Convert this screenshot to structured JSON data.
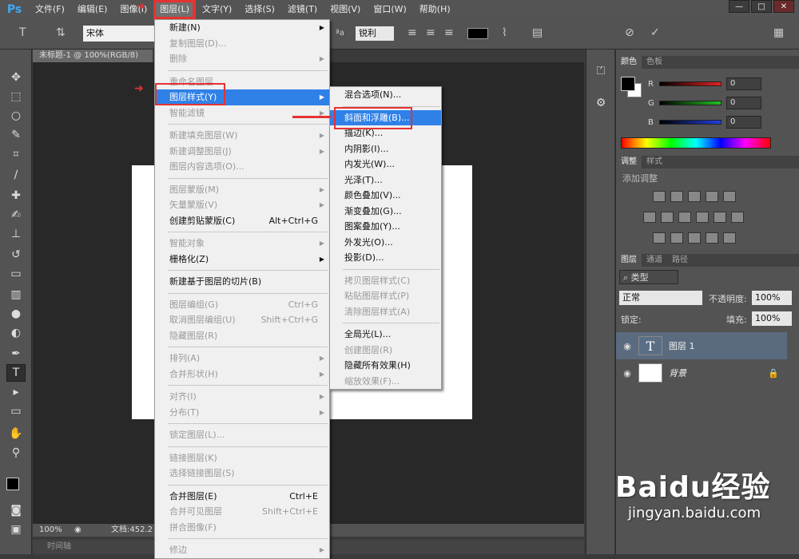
{
  "app": {
    "logo": "Ps"
  },
  "menubar": {
    "items": [
      "文件(F)",
      "编辑(E)",
      "图像(I)",
      "图层(L)",
      "文字(Y)",
      "选择(S)",
      "滤镜(T)",
      "视图(V)",
      "窗口(W)",
      "帮助(H)"
    ],
    "active_index": 3
  },
  "window_controls": [
    "—",
    "□",
    "✕"
  ],
  "options_bar": {
    "font": "宋体",
    "antialias": "锐利",
    "color": "#000000",
    "aa_label": "ªa"
  },
  "document": {
    "tab_title": "未标题-1 @ 100%(RGB/8)",
    "zoom": "100%",
    "doc_info": "文档:452.2",
    "timeline": "时间轴"
  },
  "layer_menu": [
    {
      "label": "新建(N)",
      "arrow": true
    },
    {
      "label": "复制图层(D)...",
      "disabled": true
    },
    {
      "label": "删除",
      "arrow": true,
      "disabled": true
    },
    {
      "sep": true
    },
    {
      "label": "重命名图层...",
      "disabled": true
    },
    {
      "label": "图层样式(Y)",
      "arrow": true,
      "highlighted": true
    },
    {
      "label": "智能滤镜",
      "arrow": true,
      "disabled": true
    },
    {
      "sep": true
    },
    {
      "label": "新建填充图层(W)",
      "arrow": true,
      "disabled": true
    },
    {
      "label": "新建调整图层(J)",
      "arrow": true,
      "disabled": true
    },
    {
      "label": "图层内容选项(O)...",
      "disabled": true
    },
    {
      "sep": true
    },
    {
      "label": "图层蒙版(M)",
      "arrow": true,
      "disabled": true
    },
    {
      "label": "矢量蒙版(V)",
      "arrow": true,
      "disabled": true
    },
    {
      "label": "创建剪贴蒙版(C)",
      "shortcut": "Alt+Ctrl+G"
    },
    {
      "sep": true
    },
    {
      "label": "智能对象",
      "arrow": true,
      "disabled": true
    },
    {
      "label": "栅格化(Z)",
      "arrow": true
    },
    {
      "sep": true
    },
    {
      "label": "新建基于图层的切片(B)"
    },
    {
      "sep": true
    },
    {
      "label": "图层编组(G)",
      "shortcut": "Ctrl+G",
      "disabled": true
    },
    {
      "label": "取消图层编组(U)",
      "shortcut": "Shift+Ctrl+G",
      "disabled": true
    },
    {
      "label": "隐藏图层(R)",
      "disabled": true
    },
    {
      "sep": true
    },
    {
      "label": "排列(A)",
      "arrow": true,
      "disabled": true
    },
    {
      "label": "合并形状(H)",
      "arrow": true,
      "disabled": true
    },
    {
      "sep": true
    },
    {
      "label": "对齐(I)",
      "arrow": true,
      "disabled": true
    },
    {
      "label": "分布(T)",
      "arrow": true,
      "disabled": true
    },
    {
      "sep": true
    },
    {
      "label": "锁定图层(L)...",
      "disabled": true
    },
    {
      "sep": true
    },
    {
      "label": "链接图层(K)",
      "disabled": true
    },
    {
      "label": "选择链接图层(S)",
      "disabled": true
    },
    {
      "sep": true
    },
    {
      "label": "合并图层(E)",
      "shortcut": "Ctrl+E"
    },
    {
      "label": "合并可见图层",
      "shortcut": "Shift+Ctrl+E",
      "disabled": true
    },
    {
      "label": "拼合图像(F)",
      "disabled": true
    },
    {
      "sep": true
    },
    {
      "label": "修边",
      "arrow": true,
      "disabled": true
    }
  ],
  "style_submenu": [
    {
      "label": "混合选项(N)..."
    },
    {
      "sep": true
    },
    {
      "label": "斜面和浮雕(B)...",
      "highlighted": true
    },
    {
      "label": "描边(K)..."
    },
    {
      "label": "内阴影(I)..."
    },
    {
      "label": "内发光(W)..."
    },
    {
      "label": "光泽(T)..."
    },
    {
      "label": "颜色叠加(V)..."
    },
    {
      "label": "渐变叠加(G)..."
    },
    {
      "label": "图案叠加(Y)..."
    },
    {
      "label": "外发光(O)..."
    },
    {
      "label": "投影(D)..."
    },
    {
      "sep": true
    },
    {
      "label": "拷贝图层样式(C)",
      "disabled": true
    },
    {
      "label": "粘贴图层样式(P)",
      "disabled": true
    },
    {
      "label": "清除图层样式(A)",
      "disabled": true
    },
    {
      "sep": true
    },
    {
      "label": "全局光(L)..."
    },
    {
      "label": "创建图层(R)",
      "disabled": true
    },
    {
      "label": "隐藏所有效果(H)"
    },
    {
      "label": "缩放效果(F)...",
      "disabled": true
    }
  ],
  "color_panel": {
    "tabs": [
      "颜色",
      "色板"
    ],
    "channels": [
      {
        "label": "R",
        "value": "0",
        "color": "#e62020"
      },
      {
        "label": "G",
        "value": "0",
        "color": "#20c020"
      },
      {
        "label": "B",
        "value": "0",
        "color": "#2040e6"
      }
    ]
  },
  "adjust_panel": {
    "tabs": [
      "调整",
      "样式"
    ],
    "title": "添加调整"
  },
  "layers_panel": {
    "tabs": [
      "图层",
      "通道",
      "路径"
    ],
    "filter": "类型",
    "blend_mode": "正常",
    "opacity_label": "不透明度:",
    "opacity": "100%",
    "lock_label": "锁定:",
    "fill_label": "填充:",
    "fill": "100%",
    "layers": [
      {
        "name": "图层 1",
        "thumb": "T",
        "selected": true
      },
      {
        "name": "背景",
        "thumb": "",
        "locked": true
      }
    ]
  },
  "watermark": {
    "logo": "Baidu经验",
    "url": "jingyan.baidu.com"
  }
}
